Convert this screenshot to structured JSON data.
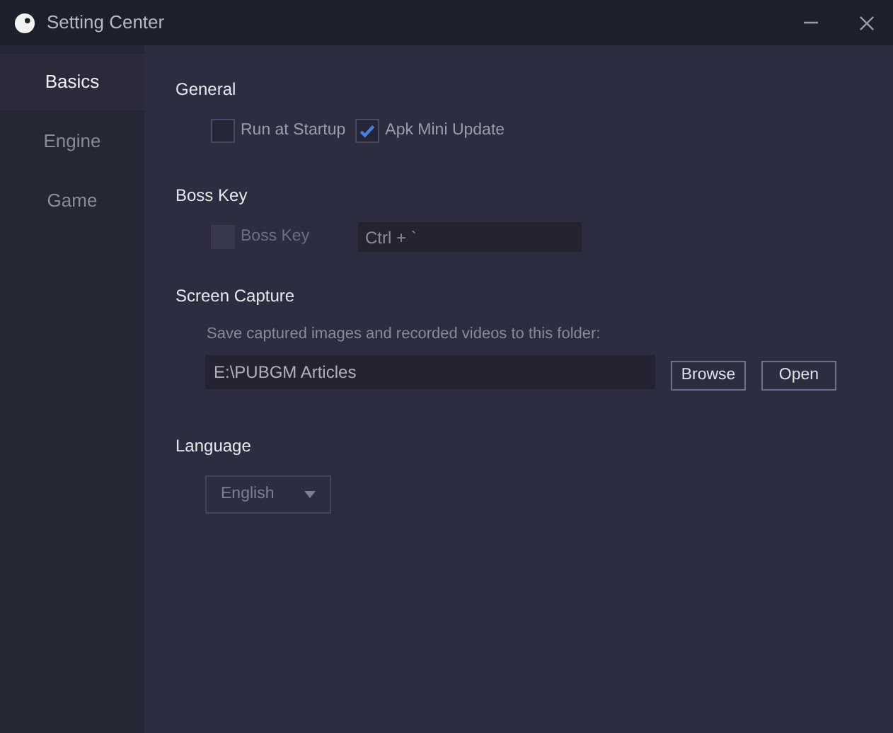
{
  "window": {
    "title": "Setting Center"
  },
  "sidebar": {
    "items": [
      {
        "label": "Basics",
        "selected": true
      },
      {
        "label": "Engine",
        "selected": false
      },
      {
        "label": "Game",
        "selected": false
      }
    ]
  },
  "general": {
    "heading": "General",
    "options": [
      {
        "label": "Run at Startup",
        "checked": false
      },
      {
        "label": "Apk Mini Update",
        "checked": true
      }
    ]
  },
  "boss_key": {
    "heading": "Boss Key",
    "option": {
      "label": "Boss Key",
      "checked": false,
      "disabled": true
    },
    "shortcut": "Ctrl + `"
  },
  "screen_capture": {
    "heading": "Screen Capture",
    "hint": "Save captured images and recorded videos to this folder:",
    "folder": "E:\\PUBGM Articles",
    "buttons": [
      "Browse",
      "Open"
    ]
  },
  "language": {
    "heading": "Language",
    "value": "English",
    "disabled": true
  }
}
